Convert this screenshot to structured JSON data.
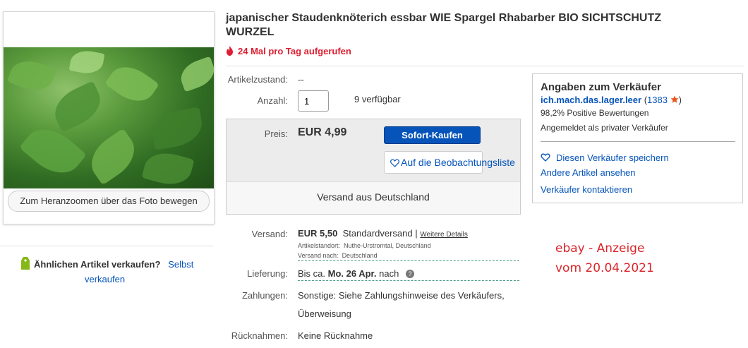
{
  "gallery": {
    "zoom_hint": "Zum Heranzoomen über das Foto bewegen"
  },
  "sell_similar": {
    "question": "Ähnlichen Artikel verkaufen?",
    "link_part1": "Selbst",
    "link_part2": "verkaufen"
  },
  "listing": {
    "title_line1": "japanischer Staudenknöterich essbar WIE Spargel Rhabarber BIO SICHTSCHUTZ",
    "title_line2": "WURZEL",
    "views": "24 Mal pro Tag aufgerufen"
  },
  "condition": {
    "label": "Artikelzustand:",
    "value": "--"
  },
  "quantity": {
    "label": "Anzahl:",
    "value": "1",
    "available": "9 verfügbar"
  },
  "price": {
    "label": "Preis:",
    "value": "EUR 4,99",
    "buy_now": "Sofort-Kaufen",
    "watch": "Auf die Beobachtungsliste",
    "ships_from": "Versand aus Deutschland"
  },
  "shipping": {
    "label": "Versand:",
    "cost": "EUR 5,50",
    "method": "Standardversand",
    "separator": "|",
    "details_link": "Weitere Details",
    "location_label": "Artikelstandort:",
    "location": "Nuthe-Urstromtal, Deutschland",
    "ships_to_label": "Versand nach:",
    "ships_to": "Deutschland"
  },
  "delivery": {
    "label": "Lieferung:",
    "prefix": "Bis ca.",
    "date": "Mo. 26 Apr.",
    "suffix": "nach",
    "info_icon": "?"
  },
  "payments": {
    "label": "Zahlungen:",
    "line1": "Sonstige: Siehe Zahlungshinweise des Verkäufers,",
    "line2": "Überweisung"
  },
  "returns": {
    "label": "Rücknahmen:",
    "value": "Keine Rücknahme"
  },
  "seller": {
    "heading": "Angaben zum Verkäufer",
    "name": "ich.mach.das.lager.leer",
    "feedback_open": "(",
    "feedback_count": "1383",
    "feedback_close": ")",
    "positive": "98,2% Positive Bewertungen",
    "registered": "Angemeldet als privater Verkäufer",
    "save": "Diesen Verkäufer speichern",
    "other_items": "Andere Artikel ansehen",
    "contact": "Verkäufer kontaktieren"
  },
  "annotation": {
    "line1": "ebay - Anzeige",
    "line2": "vom 20.04.2021"
  },
  "colors": {
    "link": "#0654ba",
    "buy_button": "#0654ba",
    "views_red": "#dd1e31",
    "star": "#e8541e",
    "annotation_red": "#d9262c"
  }
}
